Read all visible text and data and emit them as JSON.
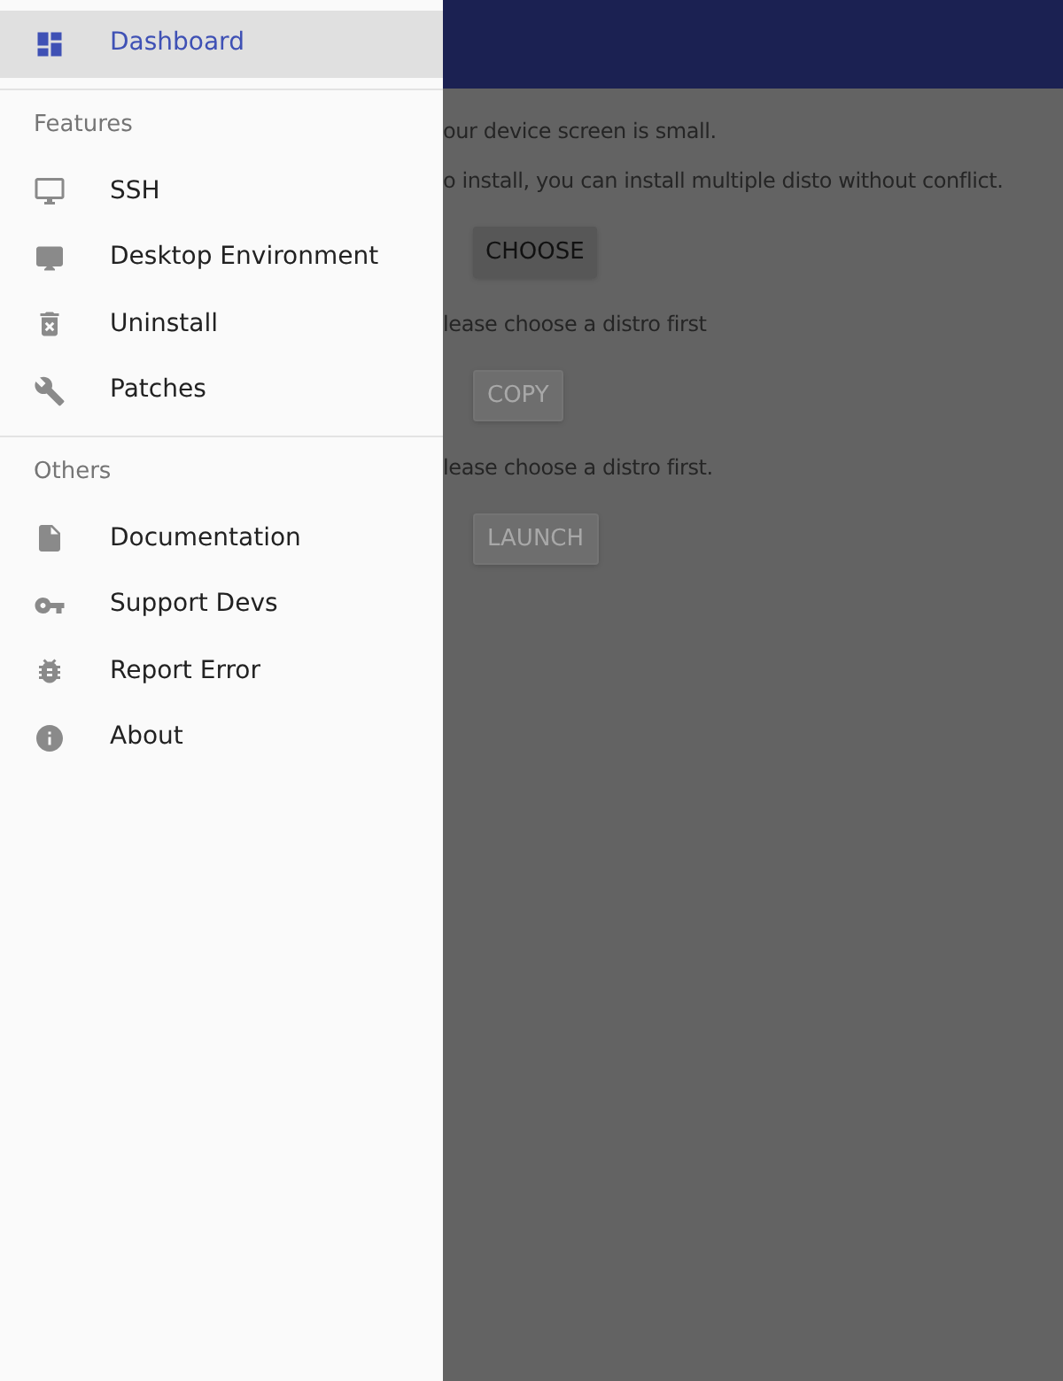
{
  "drawer": {
    "items": [
      {
        "label": "Dashboard",
        "selected": true
      }
    ],
    "sections": [
      {
        "title": "Features",
        "items": [
          {
            "label": "SSH",
            "selected": false
          },
          {
            "label": "Desktop Environment",
            "selected": false
          },
          {
            "label": "Uninstall",
            "selected": false
          },
          {
            "label": "Patches",
            "selected": false
          }
        ]
      },
      {
        "title": "Others",
        "items": [
          {
            "label": "Documentation",
            "selected": false
          },
          {
            "label": "Support Devs",
            "selected": false
          },
          {
            "label": "Report Error",
            "selected": false
          },
          {
            "label": "About",
            "selected": false
          }
        ]
      }
    ]
  },
  "content": [
    {
      "kind": "text",
      "text": "our device screen is small."
    },
    {
      "kind": "text",
      "text": "o install, you can install multiple disto without conflict."
    },
    {
      "kind": "button",
      "label": "CHOOSE",
      "disabled": false
    },
    {
      "kind": "text",
      "text": "lease choose a distro first"
    },
    {
      "kind": "button",
      "label": "COPY",
      "disabled": true
    },
    {
      "kind": "text",
      "text": "lease choose a distro first."
    },
    {
      "kind": "button",
      "label": "LAUNCH",
      "disabled": true
    }
  ]
}
